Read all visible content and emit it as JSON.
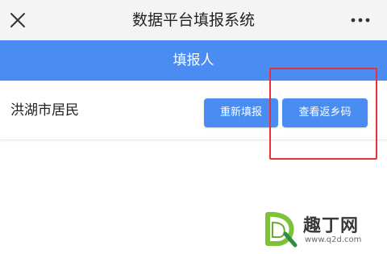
{
  "titlebar": {
    "close_icon": "close-icon",
    "title": "数据平台填报系统",
    "more_icon": "more-icon"
  },
  "section_header": {
    "label": "填报人"
  },
  "resident_row": {
    "label": "洪湖市居民",
    "refill_button": "重新填报",
    "view_button": "查看返乡码"
  },
  "watermark": {
    "name": "趣丁网",
    "url": "www.q2d.com"
  },
  "colors": {
    "accent": "#4a8cf2",
    "highlight": "#e8313a",
    "titlebar_bg": "#f4f4f4",
    "watermark_green": "#7ec23a"
  }
}
